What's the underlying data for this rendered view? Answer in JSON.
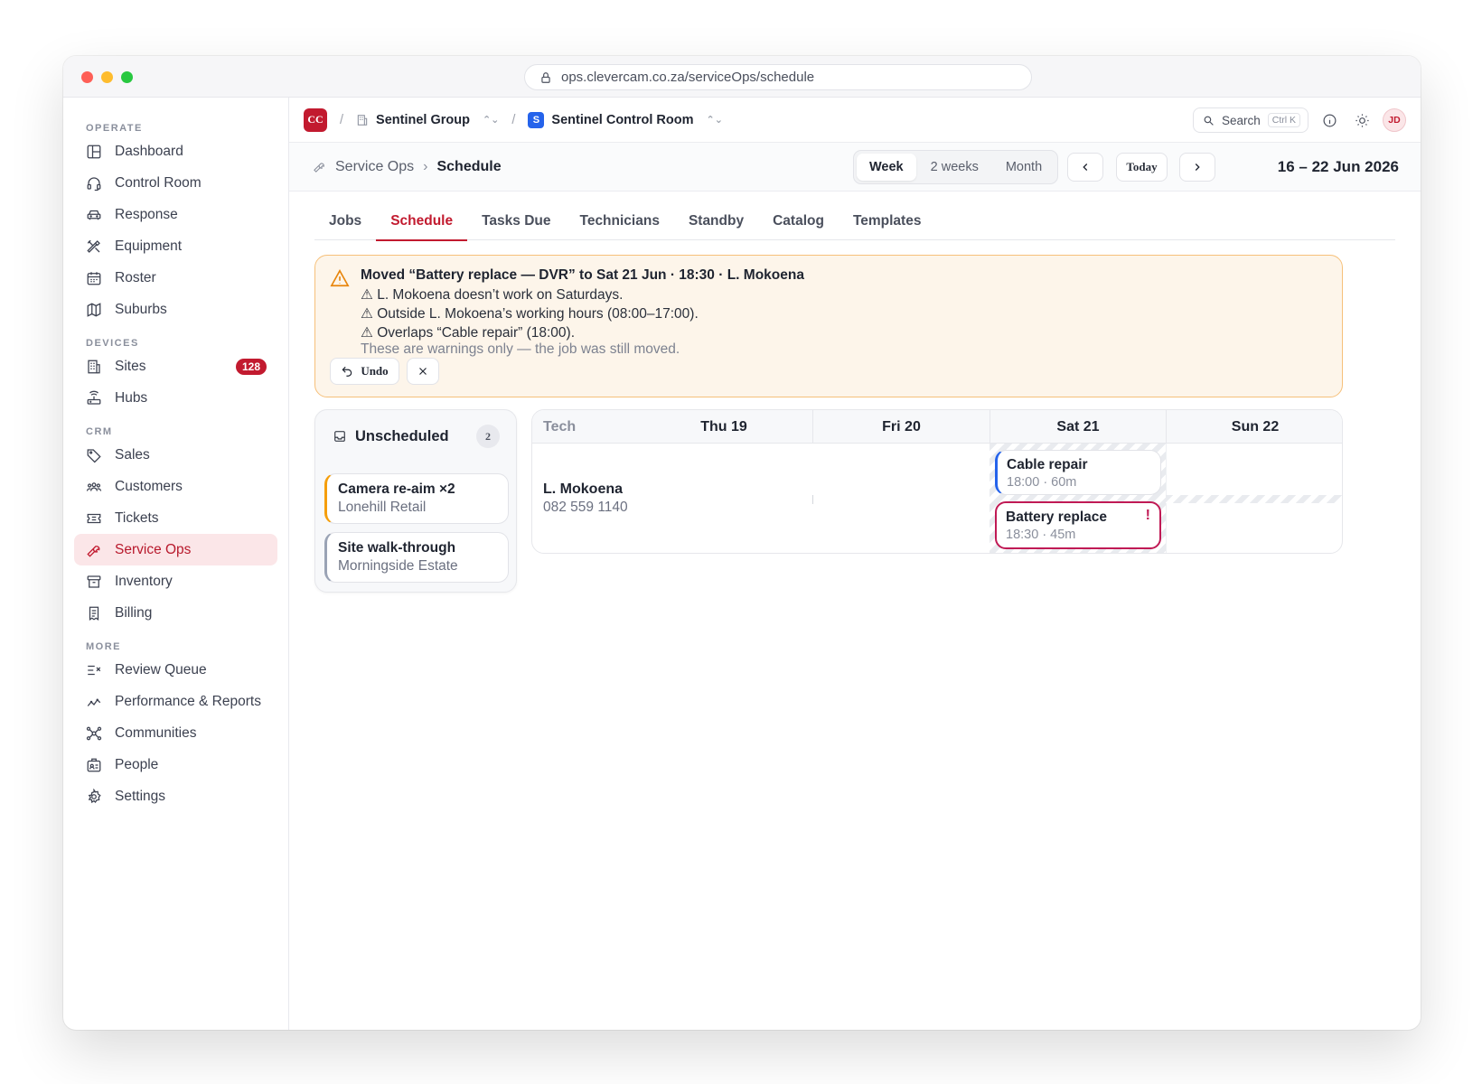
{
  "browser": {
    "url": "ops.clevercam.co.za/serviceOps/schedule"
  },
  "sidebar": {
    "sections": [
      {
        "label": "OPERATE",
        "items": [
          {
            "label": "Dashboard",
            "icon": "dashboard-icon"
          },
          {
            "label": "Control Room",
            "icon": "headset-icon"
          },
          {
            "label": "Response",
            "icon": "car-icon"
          },
          {
            "label": "Equipment",
            "icon": "tools-icon"
          },
          {
            "label": "Roster",
            "icon": "calendar-icon"
          },
          {
            "label": "Suburbs",
            "icon": "map-icon"
          }
        ]
      },
      {
        "label": "DEVICES",
        "items": [
          {
            "label": "Sites",
            "icon": "building-icon",
            "badge": "128"
          },
          {
            "label": "Hubs",
            "icon": "router-icon"
          }
        ]
      },
      {
        "label": "CRM",
        "items": [
          {
            "label": "Sales",
            "icon": "tag-icon"
          },
          {
            "label": "Customers",
            "icon": "users-icon"
          },
          {
            "label": "Tickets",
            "icon": "ticket-icon"
          },
          {
            "label": "Service Ops",
            "icon": "wrench-icon",
            "active": true
          },
          {
            "label": "Inventory",
            "icon": "archive-icon"
          },
          {
            "label": "Billing",
            "icon": "receipt-icon"
          }
        ]
      },
      {
        "label": "MORE",
        "items": [
          {
            "label": "Review Queue",
            "icon": "list-check-icon"
          },
          {
            "label": "Performance & Reports",
            "icon": "chart-line-icon"
          },
          {
            "label": "Communities",
            "icon": "network-icon"
          },
          {
            "label": "People",
            "icon": "id-badge-icon"
          },
          {
            "label": "Settings",
            "icon": "gear-icon"
          }
        ]
      }
    ]
  },
  "topbar": {
    "logo": "CC",
    "org": "Sentinel Group",
    "workspace_logo": "S",
    "workspace": "Sentinel Control Room",
    "search_label": "Search",
    "search_shortcut": "Ctrl K",
    "avatar": "JD"
  },
  "pagebar": {
    "breadcrumb_parent": "Service Ops",
    "breadcrumb_current": "Schedule",
    "view_options": [
      "Week",
      "2 weeks",
      "Month"
    ],
    "selected_view": "Week",
    "today_label": "Today",
    "date_range": "16 – 22 Jun 2026"
  },
  "tabs": [
    "Jobs",
    "Schedule",
    "Tasks Due",
    "Technicians",
    "Standby",
    "Catalog",
    "Templates"
  ],
  "active_tab": "Schedule",
  "alert": {
    "title": "Moved “Battery replace — DVR” to Sat 21 Jun · 18:30 · L. Mokoena",
    "warnings": [
      "⚠ L. Mokoena doesn’t work on Saturdays.",
      "⚠ Outside L. Mokoena’s working hours (08:00–17:00).",
      "⚠ Overlaps “Cable repair” (18:00)."
    ],
    "note": "These are warnings only — the job was still moved.",
    "undo_label": "Undo",
    "colors": {
      "border": "#f6c07a",
      "background": "#fdf5ea"
    }
  },
  "unscheduled": {
    "title": "Unscheduled",
    "count": "2",
    "cards": [
      {
        "title": "Camera re-aim ×2",
        "subtitle": "Lonehill Retail"
      },
      {
        "title": "Site walk-through",
        "subtitle": "Morningside Estate"
      }
    ]
  },
  "schedule": {
    "tech_header": "Tech",
    "days": [
      "Thu 19",
      "Fri 20",
      "Sat 21",
      "Sun 22"
    ],
    "technician": {
      "name": "L. Mokoena",
      "phone": "082 559 1140"
    },
    "jobs": [
      {
        "title": "Cable repair",
        "meta": "18:00 · 60m",
        "day": "Sat 21",
        "status": "ok"
      },
      {
        "title": "Battery replace",
        "meta": "18:30 · 45m",
        "day": "Sat 21",
        "status": "warning",
        "flag": "!"
      }
    ]
  },
  "colors": {
    "brand": "#c21a2f",
    "job_blue": "#2563eb",
    "job_conflict": "#c01a55"
  }
}
